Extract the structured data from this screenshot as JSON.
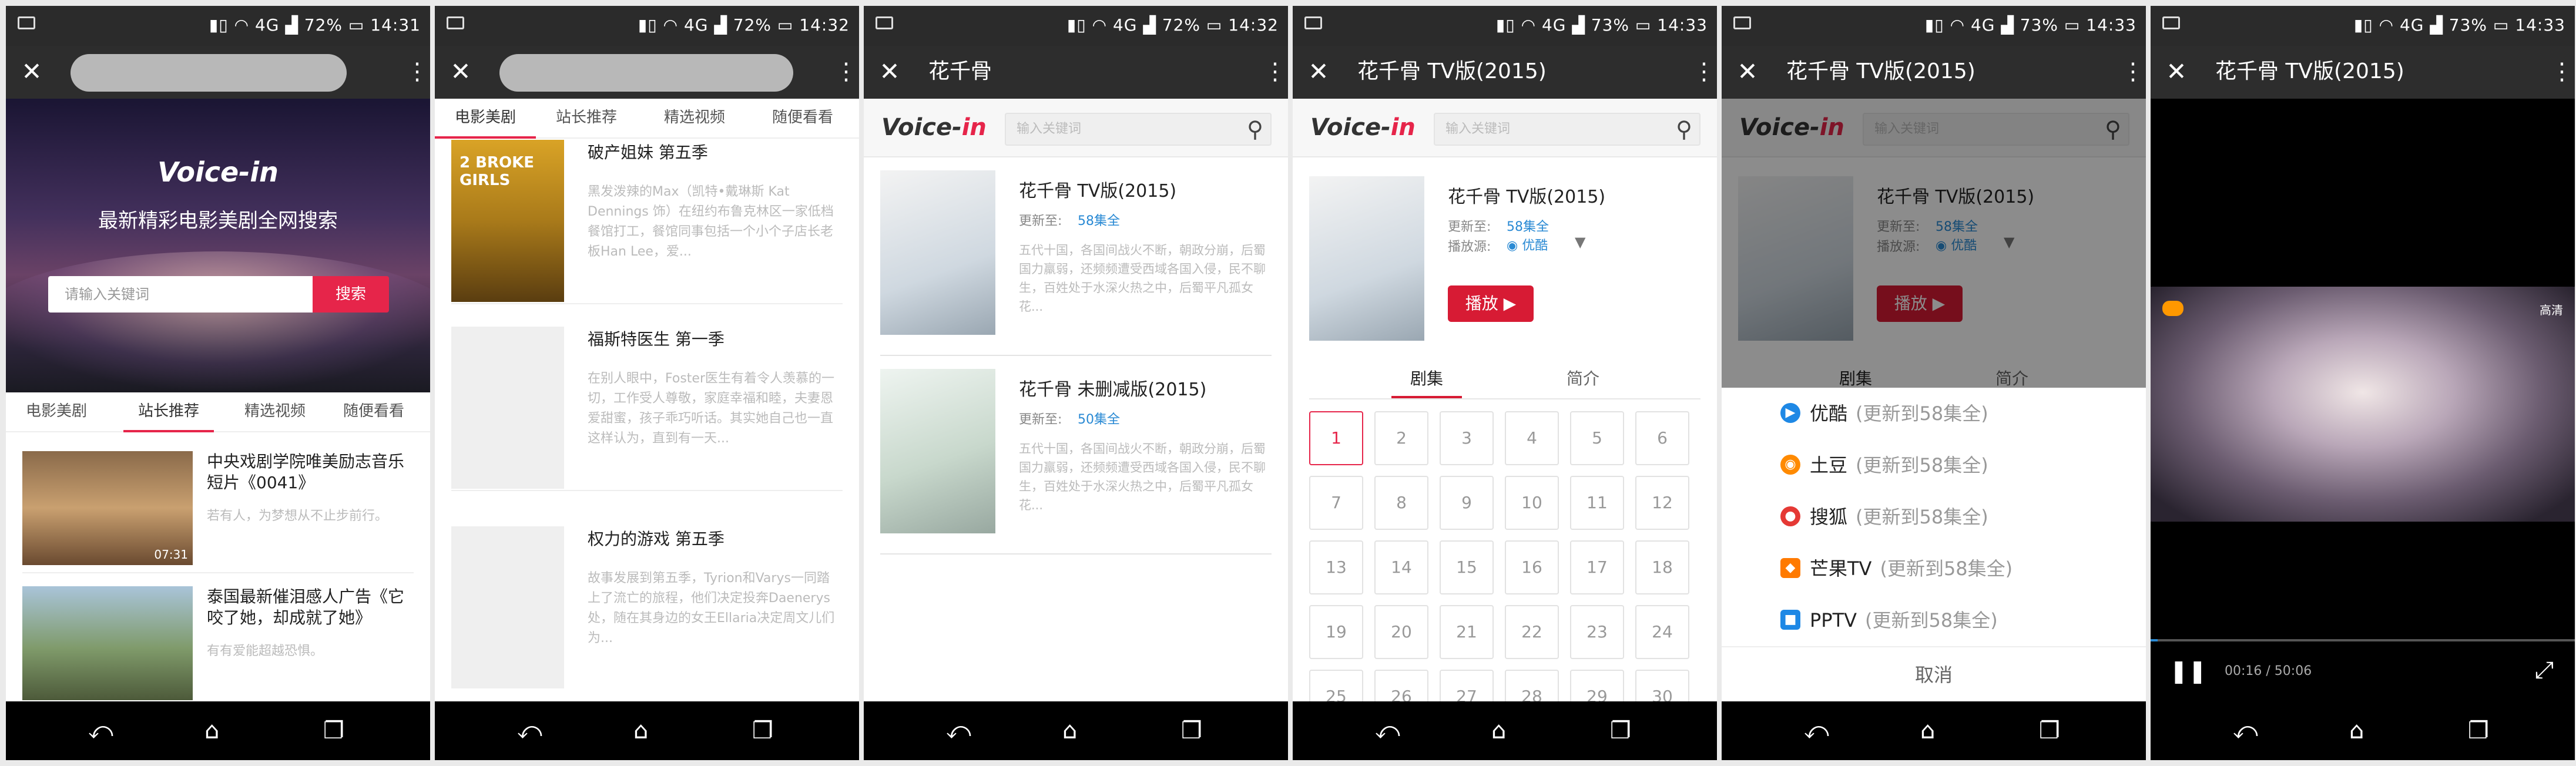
{
  "status": {
    "screens": [
      {
        "battery": "72%",
        "time": "14:31"
      },
      {
        "battery": "72%",
        "time": "14:32"
      },
      {
        "battery": "72%",
        "time": "14:32"
      },
      {
        "battery": "73%",
        "time": "14:33"
      },
      {
        "battery": "73%",
        "time": "14:33"
      },
      {
        "battery": "73%",
        "time": "14:33"
      }
    ],
    "signal": "4G"
  },
  "nav": {
    "back": "⤺",
    "home": "⌂",
    "recent": "❐"
  },
  "appbar": {
    "close": "✕",
    "more": "⋮"
  },
  "brand": {
    "logo_a": "Voice-",
    "logo_b": "in",
    "accent": "#e6254a"
  },
  "screen1": {
    "logo": "Voice-in",
    "slogan": "最新精彩电影美剧全网搜索",
    "search_placeholder": "请输入关键词",
    "search_button": "搜索",
    "tabs": [
      "电影美剧",
      "站长推荐",
      "精选视频",
      "随便看看"
    ],
    "items": [
      {
        "title": "中央戏剧学院唯美励志音乐短片《0041》",
        "desc": "若有人，为梦想从不止步前行。",
        "duration": "07:31"
      },
      {
        "title": "泰国最新催泪感人广告《它咬了她，却成就了她》",
        "desc": "有有爱能超越恐惧。"
      }
    ]
  },
  "screen2": {
    "tabs": [
      "电影美剧",
      "站长推荐",
      "精选视频",
      "随便看看"
    ],
    "items": [
      {
        "title": "破产姐妹 第五季",
        "poster_text": "2 BROKE GIRLS",
        "desc": "黑发泼辣的Max（凯特•戴琳斯 Kat Dennings 饰）在纽约布鲁克林区一家低档餐馆打工，餐馆同事包括一个小个子店长老板Han Lee，爱..."
      },
      {
        "title": "福斯特医生 第一季",
        "desc": "在别人眼中，Foster医生有着令人羡慕的一切，工作受人尊敬，家庭幸福和睦，夫妻恩爱甜蜜，孩子乖巧听话。其实她自己也一直这样认为，直到有一天..."
      },
      {
        "title": "权力的游戏 第五季",
        "desc": "故事发展到第五季，Tyrion和Varys一同踏上了流亡的旅程，他们决定投奔Daenerys处，随在其身边的女王Ellaria决定周文儿们为..."
      }
    ]
  },
  "screen3": {
    "title": "花千骨",
    "search_placeholder": "输入关键词",
    "results": [
      {
        "title": "花千骨 TV版(2015)",
        "update_label": "更新至:",
        "update_value": "58集全",
        "desc": "五代十国，各国间战火不断，朝政分崩，后蜀国力羸弱，还频频遭受西域各国入侵，民不聊生，百姓处于水深火热之中，后蜀平凡孤女花..."
      },
      {
        "title": "花千骨 未删减版(2015)",
        "update_label": "更新至:",
        "update_value": "50集全",
        "desc": "五代十国，各国间战火不断，朝政分崩，后蜀国力羸弱，还频频遭受西域各国入侵，民不聊生，百姓处于水深火热之中，后蜀平凡孤女花..."
      }
    ]
  },
  "screen4": {
    "title": "花千骨 TV版(2015)",
    "search_placeholder": "输入关键词",
    "detail": {
      "title": "花千骨 TV版(2015)",
      "update_label": "更新至:",
      "update_value": "58集全",
      "source_label": "播放源:",
      "source_value": "优酷",
      "play": "播放 ▶"
    },
    "segments": [
      "剧集",
      "简介"
    ],
    "episodes": [
      "1",
      "2",
      "3",
      "4",
      "5",
      "6",
      "7",
      "8",
      "9",
      "10",
      "11",
      "12",
      "13",
      "14",
      "15",
      "16",
      "17",
      "18",
      "19",
      "20",
      "21",
      "22",
      "23",
      "24",
      "25",
      "26",
      "27",
      "28",
      "29",
      "30"
    ]
  },
  "screen5": {
    "title": "花千骨 TV版(2015)",
    "search_placeholder": "输入关键词",
    "detail": {
      "title": "花千骨 TV版(2015)",
      "update_label": "更新至:",
      "update_value": "58集全",
      "source_label": "播放源:",
      "source_value": "优酷",
      "play": "播放 ▶"
    },
    "segments": [
      "剧集",
      "简介"
    ],
    "sources": [
      {
        "name": "优酷",
        "note": "(更新到58集全)",
        "icon": "youku-icon",
        "color": "#1e88e5",
        "glyph": "▶"
      },
      {
        "name": "土豆",
        "note": "(更新到58集全)",
        "icon": "tudou-icon",
        "color": "#ff8a00",
        "glyph": "◉"
      },
      {
        "name": "搜狐",
        "note": "(更新到58集全)",
        "icon": "sohu-icon",
        "color": "#e53935",
        "glyph": "●"
      },
      {
        "name": "芒果TV",
        "note": "(更新到58集全)",
        "icon": "mango-icon",
        "color": "#ff7a00",
        "glyph": "◆"
      },
      {
        "name": "PPTV",
        "note": "(更新到58集全)",
        "icon": "pptv-icon",
        "color": "#1e88e5",
        "glyph": "■"
      }
    ],
    "cancel": "取消"
  },
  "screen6": {
    "title": "花千骨 TV版(2015)",
    "subtitle_overlay": "高清",
    "time": "00:16 / 50:06",
    "progress": 0.005,
    "pause": "❚❚",
    "fullscreen": "⤢"
  }
}
